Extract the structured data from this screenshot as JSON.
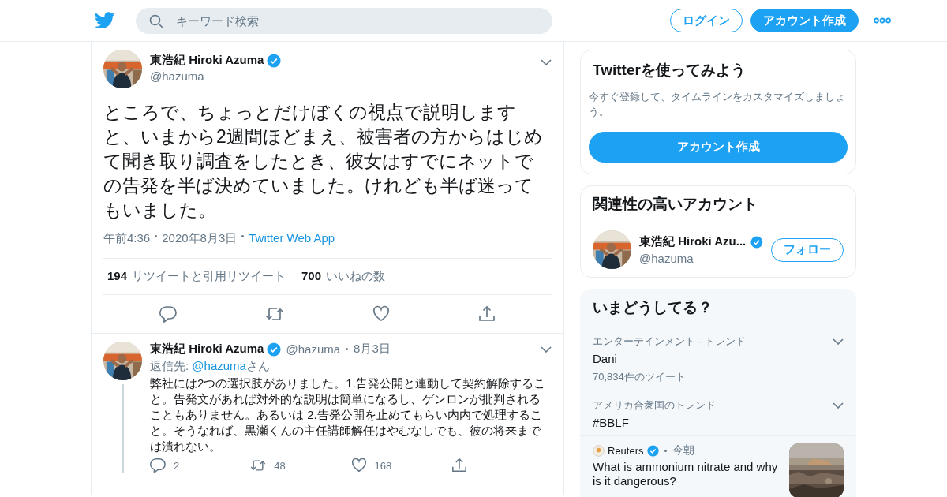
{
  "header": {
    "search": {
      "placeholder": "キーワード検索"
    },
    "login": "ログイン",
    "signup": "アカウント作成"
  },
  "tweet": {
    "name": "東浩紀 Hiroki Azuma",
    "verified": true,
    "handle": "@hazuma",
    "text": "ところで、ちょっとだけぼくの視点で説明しますと、いまから2週間ほどまえ、被害者の方からはじめて聞き取り調査をしたとき、彼女はすでにネットでの告発を半ば決めていました。けれども半ば迷ってもいました。",
    "time": "午前4:36",
    "date": "2020年8月3日",
    "source": "Twitter Web App",
    "retweets": {
      "count": "194",
      "label": "リツイートと引用リツイート"
    },
    "likes": {
      "count": "700",
      "label": "いいねの数"
    }
  },
  "replies": [
    {
      "name": "東浩紀 Hiroki Azuma",
      "verified": true,
      "handle": "@hazuma",
      "date": "8月3日",
      "reply_to_label": "返信先:",
      "reply_to": "@hazuma",
      "reply_to_suffix": "さん",
      "text": "弊社には2つの選択肢がありました。1.告発公開と連動して契約解除すること。告発文があれば対外的な説明は簡単になるし、ゲンロンが批判されることもありません。あるいは 2.告発公開を止めてもらい内内で処理すること。そうなれば、黒瀬くんの主任講師解任はやむなしでも、彼の将来までは潰れない。",
      "replies": "2",
      "retweets": "48",
      "likes": "168",
      "thread": true
    }
  ],
  "sidebar": {
    "signup_card": {
      "title": "Twitterを使ってみよう",
      "text": "今すぐ登録して、タイムラインをカスタマイズしましょう。",
      "button": "アカウント作成"
    },
    "related": {
      "title": "関連性の高いアカウント",
      "accounts": [
        {
          "name": "東浩紀 Hiroki Azu...",
          "verified": true,
          "handle": "@hazuma",
          "button": "フォロー"
        }
      ]
    },
    "trends": {
      "title": "いまどうしてる？",
      "items": [
        {
          "kind": "trend",
          "context": "エンターテインメント · トレンド",
          "name": "Dani",
          "count": "70,834件のツイート"
        },
        {
          "kind": "trend",
          "context": "アメリカ合衆国のトレンド",
          "name": "#BBLF"
        },
        {
          "kind": "news",
          "source": "Reuters",
          "verified": true,
          "time": "今朝",
          "headline": "What is ammonium nitrate and why is it dangerous?"
        }
      ]
    }
  }
}
